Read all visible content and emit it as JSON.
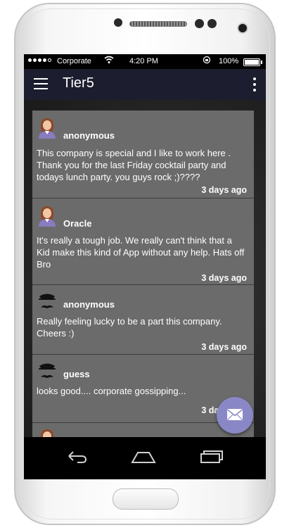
{
  "status_bar": {
    "carrier": "Corporate",
    "time": "4:20 PM",
    "battery": "100%"
  },
  "app_bar": {
    "title": "Tier5"
  },
  "posts": [
    {
      "user": "anonymous",
      "avatar": "female-avatar",
      "message": "This company is special and I like to work here . Thank you for the last Friday cocktail party and todays lunch party. you guys rock ;)????",
      "time": "3 days ago"
    },
    {
      "user": "Oracle",
      "avatar": "female-avatar",
      "message": "It's really a tough job. We really can't think that a Kid make this kind of App without any help. Hats off Bro",
      "time": "3 days ago"
    },
    {
      "user": "anonymous",
      "avatar": "mustache-avatar",
      "message": "Really feeling lucky to be a part this company. Cheers :)",
      "time": "3 days ago"
    },
    {
      "user": "guess",
      "avatar": "mustache-avatar",
      "message": "looks good.... corporate gossipping...",
      "time": "3 days ago"
    }
  ],
  "fab": {
    "icon": "mail-icon"
  },
  "colors": {
    "app_bar": "#1c1d2e",
    "card": "#6b6b6b",
    "fab": "#8a87c7",
    "avatar_accent": "#8a7bc0"
  }
}
